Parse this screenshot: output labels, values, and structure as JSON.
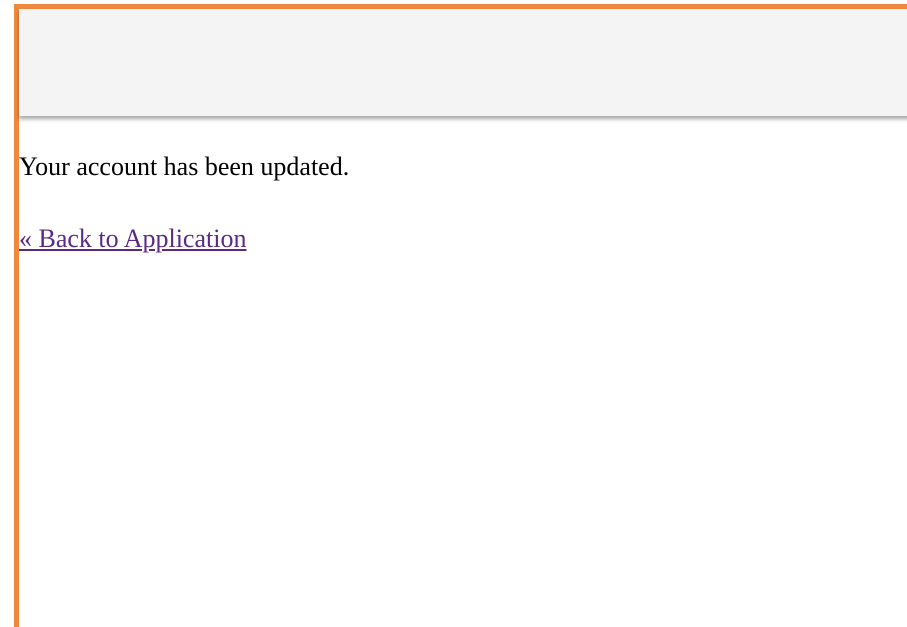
{
  "page": {
    "message": "Your account has been updated.",
    "back_link_label": "« Back to Application"
  },
  "colors": {
    "frame_border": "#f0883d",
    "header_background": "#f4f4f4",
    "link": "#5b2a86"
  }
}
